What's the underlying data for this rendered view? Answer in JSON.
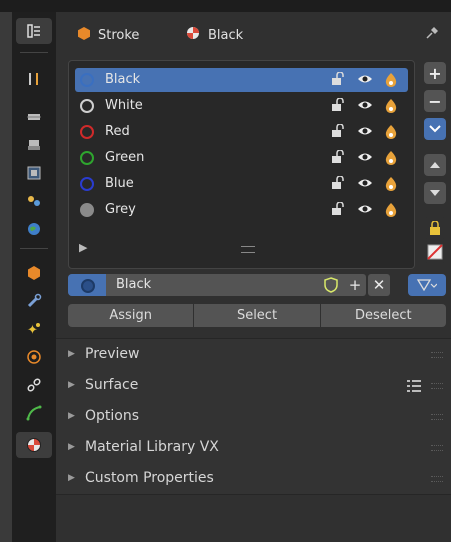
{
  "header": {
    "object_name": "Stroke",
    "material_name": "Black"
  },
  "materials": [
    {
      "name": "Black",
      "color": "#3a6fc0",
      "selected": true
    },
    {
      "name": "White",
      "color": "#cfcfcf",
      "selected": false
    },
    {
      "name": "Red",
      "color": "#d02a2a",
      "selected": false
    },
    {
      "name": "Green",
      "color": "#2ea52e",
      "selected": false
    },
    {
      "name": "Blue",
      "color": "#2a3ccf",
      "selected": false
    },
    {
      "name": "Grey",
      "color": "#8a8a8a",
      "selected": false
    }
  ],
  "active_material": {
    "name": "Black"
  },
  "actions": {
    "assign": "Assign",
    "select": "Select",
    "deselect": "Deselect"
  },
  "sections": [
    "Preview",
    "Surface",
    "Options",
    "Material Library VX",
    "Custom Properties"
  ],
  "colors": {
    "accent": "#4772b3",
    "panel_bg": "#303030",
    "tab_bg": "#1f1f1f"
  }
}
